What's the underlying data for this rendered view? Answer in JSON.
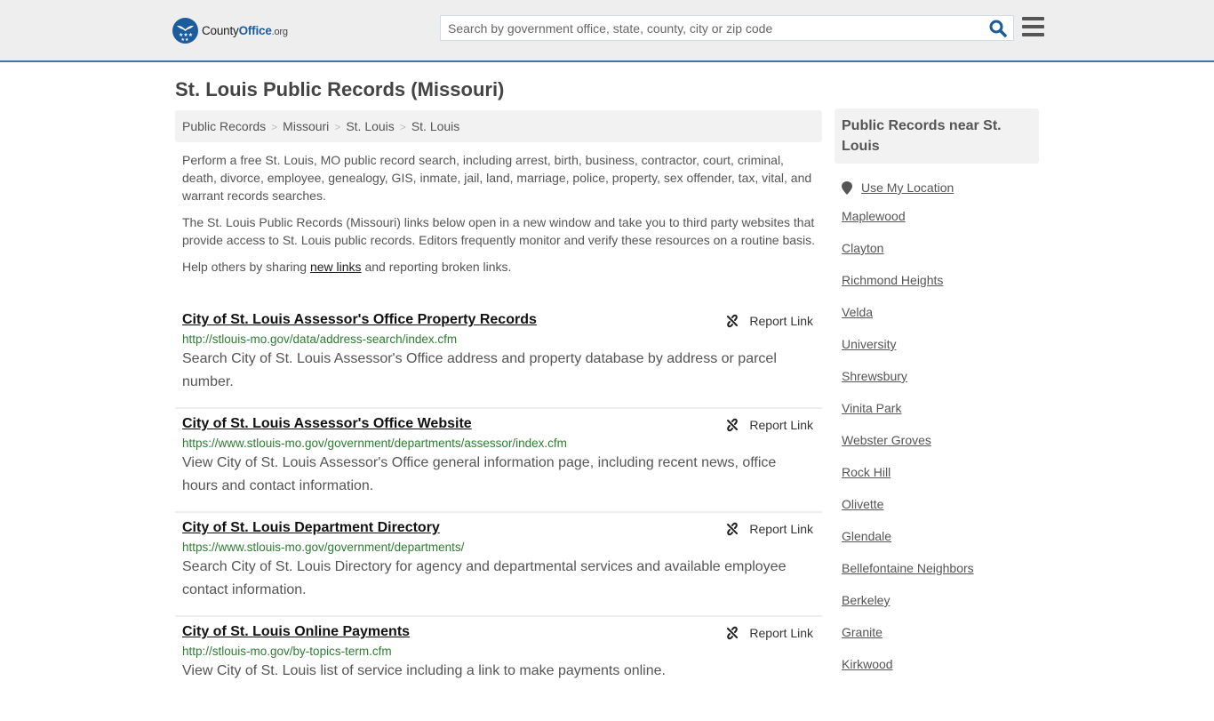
{
  "header": {
    "logo": {
      "name": "County",
      "brand": "Office",
      "tld": ".org"
    },
    "search": {
      "placeholder": "Search by government office, state, county, city or zip code",
      "value": ""
    },
    "icons": {
      "search": "search-icon",
      "menu": "hamburger-menu-icon"
    }
  },
  "page": {
    "title": "St. Louis Public Records (Missouri)"
  },
  "breadcrumb": [
    {
      "label": "Public Records"
    },
    {
      "label": "Missouri"
    },
    {
      "label": "St. Louis"
    },
    {
      "label": "St. Louis"
    }
  ],
  "intro": {
    "p1": "Perform a free St. Louis, MO public record search, including arrest, birth, business, contractor, court, criminal, death, divorce, employee, genealogy, GIS, inmate, jail, land, marriage, police, property, sex offender, tax, vital, and warrant records searches.",
    "p2": "The St. Louis Public Records (Missouri) links below open in a new window and take you to third party websites that provide access to St. Louis public records. Editors frequently monitor and verify these resources on a routine basis.",
    "p3_before": "Help others by sharing ",
    "p3_link": "new links",
    "p3_after": " and reporting broken links."
  },
  "results": [
    {
      "title": "City of St. Louis Assessor's Office Property Records",
      "url": "http://stlouis-mo.gov/data/address-search/index.cfm",
      "description": "Search City of St. Louis Assessor's Office address and property database by address or parcel number.",
      "report_label": "Report Link"
    },
    {
      "title": "City of St. Louis Assessor's Office Website",
      "url": "https://www.stlouis-mo.gov/government/departments/assessor/index.cfm",
      "description": "View City of St. Louis Assessor's Office general information page, including recent news, office hours and contact information.",
      "report_label": "Report Link"
    },
    {
      "title": "City of St. Louis Department Directory",
      "url": "https://www.stlouis-mo.gov/government/departments/",
      "description": "Search City of St. Louis Directory for agency and departmental services and available employee contact information.",
      "report_label": "Report Link"
    },
    {
      "title": "City of St. Louis Online Payments",
      "url": "http://stlouis-mo.gov/by-topics-term.cfm",
      "description": "View City of St. Louis list of service including a link to make payments online.",
      "report_label": "Report Link"
    }
  ],
  "sidebar": {
    "heading": "Public Records near St. Louis",
    "use_location": "Use My Location",
    "nearby": [
      "Maplewood",
      "Clayton",
      "Richmond Heights",
      "Velda",
      "University",
      "Shrewsbury",
      "Vinita Park",
      "Webster Groves",
      "Rock Hill",
      "Olivette",
      "Glendale",
      "Bellefontaine Neighbors",
      "Berkeley",
      "Granite",
      "Kirkwood"
    ]
  },
  "colors": {
    "brand_blue": "#1d5c9c",
    "header_border": "#3a77a8",
    "url_green": "#2e7d32"
  }
}
